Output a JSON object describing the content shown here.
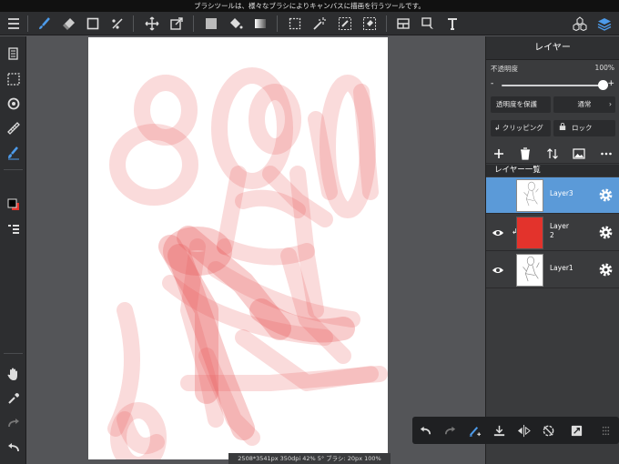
{
  "hint_text": "ブラシツールは、様々なブラシによりキャンバスに描画を行うツールです。",
  "status_text": "2508*3541px 350dpi 42% 5° ブラシ: 20px 100%",
  "colors": {
    "accent": "#5b9ad8",
    "toolbar_bg": "#2d2e30",
    "panel_bg": "#3a3b3d",
    "workspace_bg": "#545558",
    "active_tool": "#4d9bea",
    "sketch": "#e85a5a",
    "layer2_fill": "#e3332c"
  },
  "toolbar": {
    "tools": [
      "menu-icon",
      "brush-icon",
      "eraser-icon",
      "shape-icon",
      "blur-icon",
      "move-icon",
      "transform-icon",
      "fill-color-icon",
      "bucket-icon",
      "gradient-icon",
      "select-rect-icon",
      "magic-wand-icon",
      "select-pen-icon",
      "select-eraser-icon",
      "canvas-layout-icon",
      "pick-icon",
      "text-icon",
      "materials-icon",
      "layers-icon"
    ]
  },
  "left_tools": [
    "page-manager-icon",
    "selection-layer-icon",
    "snap-icon",
    "ruler-icon",
    "brush-settings-icon",
    "color-swatch",
    "layer-property-icon",
    "hand-icon",
    "eyedropper-icon",
    "redo-icon",
    "undo-icon"
  ],
  "panel": {
    "title": "レイヤー",
    "opacity_label": "不透明度",
    "opacity_value": "100%",
    "opacity_fraction": 1.0,
    "minus": "-",
    "plus": "+",
    "protect_label": "透明度を保護",
    "blend_mode": "通常",
    "clipping_label": "クリッピング",
    "lock_label": "ロック",
    "list_title": "レイヤー一覧",
    "layers": [
      {
        "name": "Layer3",
        "selected": true,
        "visible": false
      },
      {
        "name": "Layer\n2",
        "selected": false,
        "visible": true
      },
      {
        "name": "Layer1",
        "selected": false,
        "visible": true
      }
    ]
  },
  "bottom_toolbar": [
    "undo-icon",
    "redo-icon",
    "clear-icon",
    "download-icon",
    "flip-icon",
    "rotate-icon",
    "fullscreen-icon",
    "grip-icon"
  ]
}
